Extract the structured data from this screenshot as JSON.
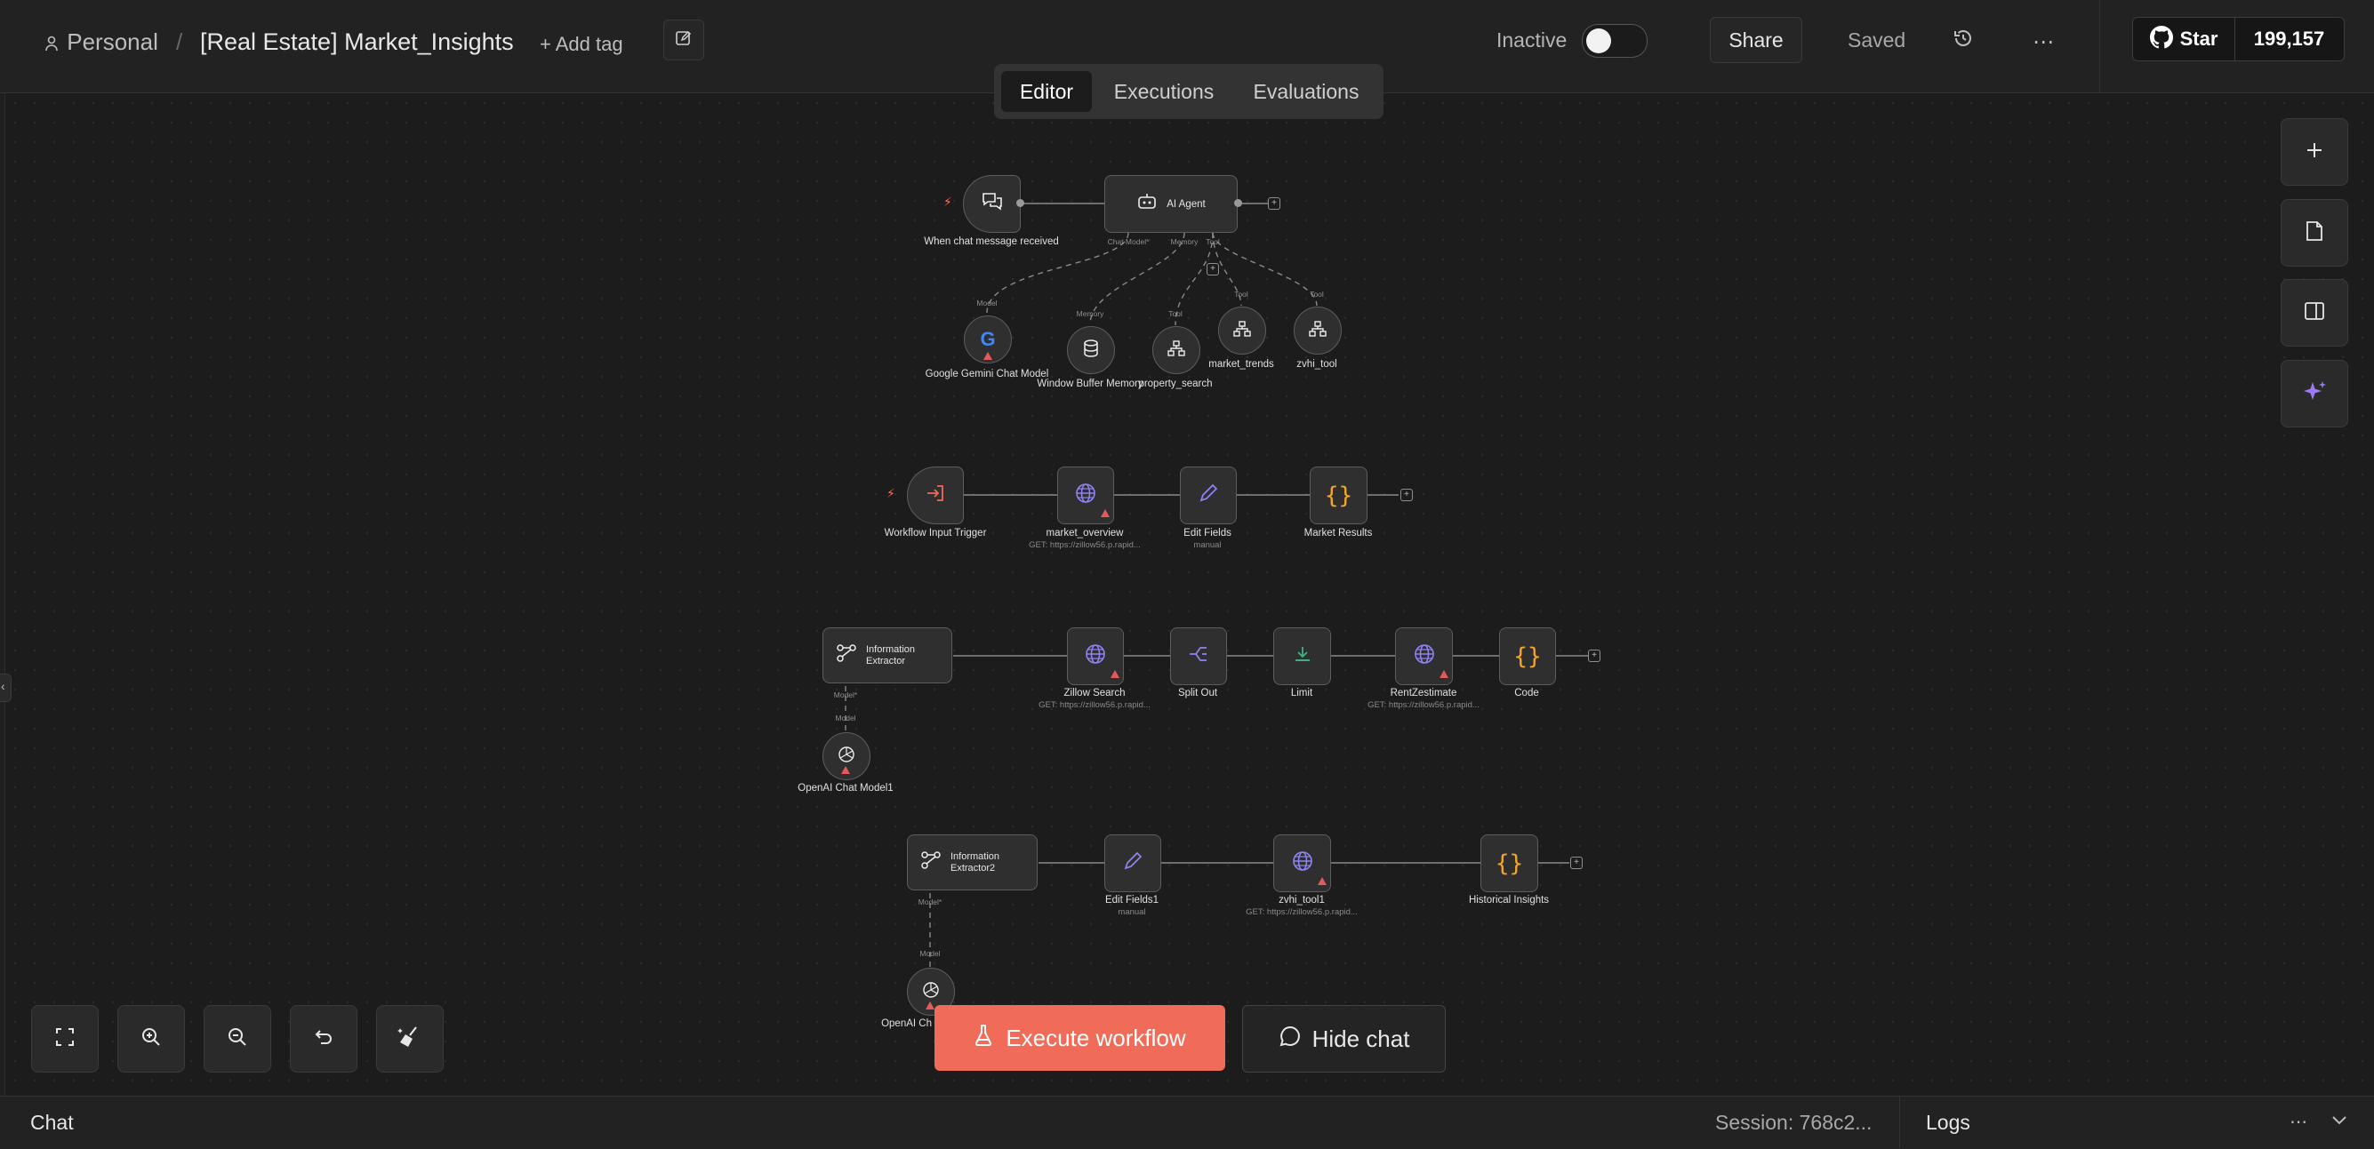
{
  "header": {
    "workspace": "Personal",
    "separator": "/",
    "workflow_name": "[Real Estate] Market_Insights",
    "add_tag": "+ Add tag",
    "status_label": "Inactive",
    "share": "Share",
    "saved": "Saved",
    "github_star": "Star",
    "github_count": "199,157"
  },
  "tabs": [
    "Editor",
    "Executions",
    "Evaluations"
  ],
  "nodes": {
    "chat_trigger": "When chat message received",
    "ai_agent": "AI Agent",
    "port_chat_model": "Chat Model*",
    "port_memory": "Memory",
    "port_tool": "Tool",
    "label_model": "Model",
    "label_memory": "Memory",
    "label_tool": "Tool",
    "gemini": "Google Gemini Chat Model",
    "memory": "Window Buffer Memory",
    "property_search": "property_search",
    "market_trends": "market_trends",
    "zvhi_tool": "zvhi_tool",
    "workflow_trigger": "Workflow Input Trigger",
    "market_overview": "market_overview",
    "market_overview_sub": "GET: https://zillow56.p.rapid...",
    "edit_fields": "Edit Fields",
    "edit_fields_sub": "manual",
    "market_results": "Market Results",
    "info_extractor": "Information Extractor",
    "model_star": "Model*",
    "model": "Model",
    "zillow_search": "Zillow Search",
    "zillow_search_sub": "GET: https://zillow56.p.rapid...",
    "split_out": "Split Out",
    "limit": "Limit",
    "rentzestimate": "RentZestimate",
    "rentzestimate_sub": "GET: https://zillow56.p.rapid...",
    "code": "Code",
    "openai1": "OpenAI Chat Model1",
    "info_extractor2": "Information Extractor2",
    "edit_fields1": "Edit Fields1",
    "edit_fields1_sub": "manual",
    "zvhi_tool1": "zvhi_tool1",
    "zvhi_tool1_sub": "GET: https://zillow56.p.rapid...",
    "historical": "Historical Insights",
    "openai2": "OpenAI Ch"
  },
  "actions": {
    "execute": "Execute workflow",
    "hide_chat": "Hide chat"
  },
  "bottom": {
    "chat": "Chat",
    "session": "Session: 768c2...",
    "logs": "Logs"
  },
  "colors": {
    "accent": "#f06b58",
    "http_icon": "#8f84f5",
    "code_icon": "#f5a623",
    "warning": "#e35a5a",
    "limit_icon": "#3fb27f"
  }
}
